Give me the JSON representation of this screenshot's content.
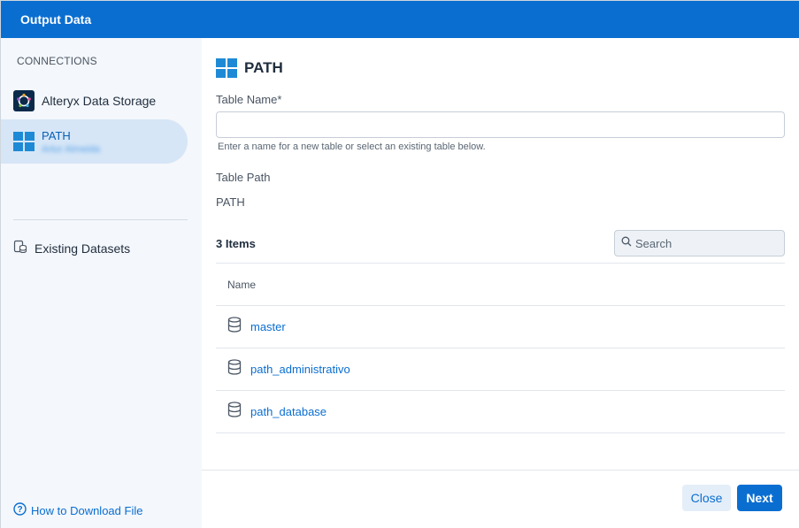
{
  "dialog": {
    "title": "Output Data"
  },
  "sidebar": {
    "heading": "CONNECTIONS",
    "connections": [
      {
        "label": "Alteryx Data Storage",
        "icon": "alteryx-logo-icon"
      },
      {
        "label": "PATH",
        "sublabel": "Artur Almeida",
        "icon": "windows-icon",
        "selected": true
      }
    ],
    "existing_datasets": "Existing Datasets",
    "help_link": "How to Download File"
  },
  "main": {
    "title": "PATH",
    "table_name_label": "Table Name*",
    "table_name_value": "",
    "table_name_placeholder": "",
    "table_name_help": "Enter a name for a new table or select an existing table below.",
    "table_path_label": "Table Path",
    "table_path_value": "PATH",
    "items_count": "3 Items",
    "search_placeholder": "Search",
    "columns": [
      "Name"
    ],
    "rows": [
      {
        "name": "master"
      },
      {
        "name": "path_administrativo"
      },
      {
        "name": "path_database"
      }
    ]
  },
  "footer": {
    "close_label": "Close",
    "next_label": "Next"
  },
  "colors": {
    "accent": "#0a6ed1",
    "selected_bg": "#d6e6f7",
    "sidebar_bg": "#f4f7fb"
  }
}
